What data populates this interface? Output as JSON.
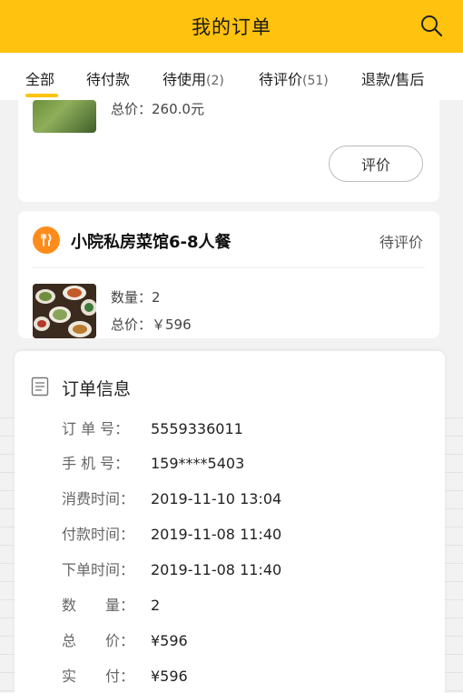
{
  "header": {
    "title": "我的订单",
    "search_icon": "search-icon"
  },
  "tabs": [
    {
      "label": "全部",
      "count": ""
    },
    {
      "label": "待付款",
      "count": ""
    },
    {
      "label": "待使用",
      "count": "(2)"
    },
    {
      "label": "待评价",
      "count": "(51)"
    },
    {
      "label": "退款/售后",
      "count": ""
    }
  ],
  "order1": {
    "total": "总价：260.0元",
    "review_button": "评价"
  },
  "order2": {
    "shop_name": "小院私房菜馆6-8人餐",
    "status": "待评价",
    "quantity": "数量：2",
    "total": "总价：￥596"
  },
  "order_info": {
    "title": "订单信息",
    "rows": [
      {
        "label": "订 单 号：",
        "value": "5559336011"
      },
      {
        "label": "手 机 号：",
        "value": "159****5403"
      },
      {
        "label": "消费时间：",
        "value": "2019-11-10 13:04"
      },
      {
        "label": "付款时间：",
        "value": "2019-11-08 11:40"
      },
      {
        "label": "下单时间：",
        "value": "2019-11-08 11:40"
      },
      {
        "label": "数　　量：",
        "value": "2"
      },
      {
        "label": "总　　价：",
        "value": "¥596"
      },
      {
        "label": "实　　付：",
        "value": "¥596"
      }
    ]
  },
  "colors": {
    "accent": "#ffc20e",
    "food_icon": "#ff8c1a"
  }
}
